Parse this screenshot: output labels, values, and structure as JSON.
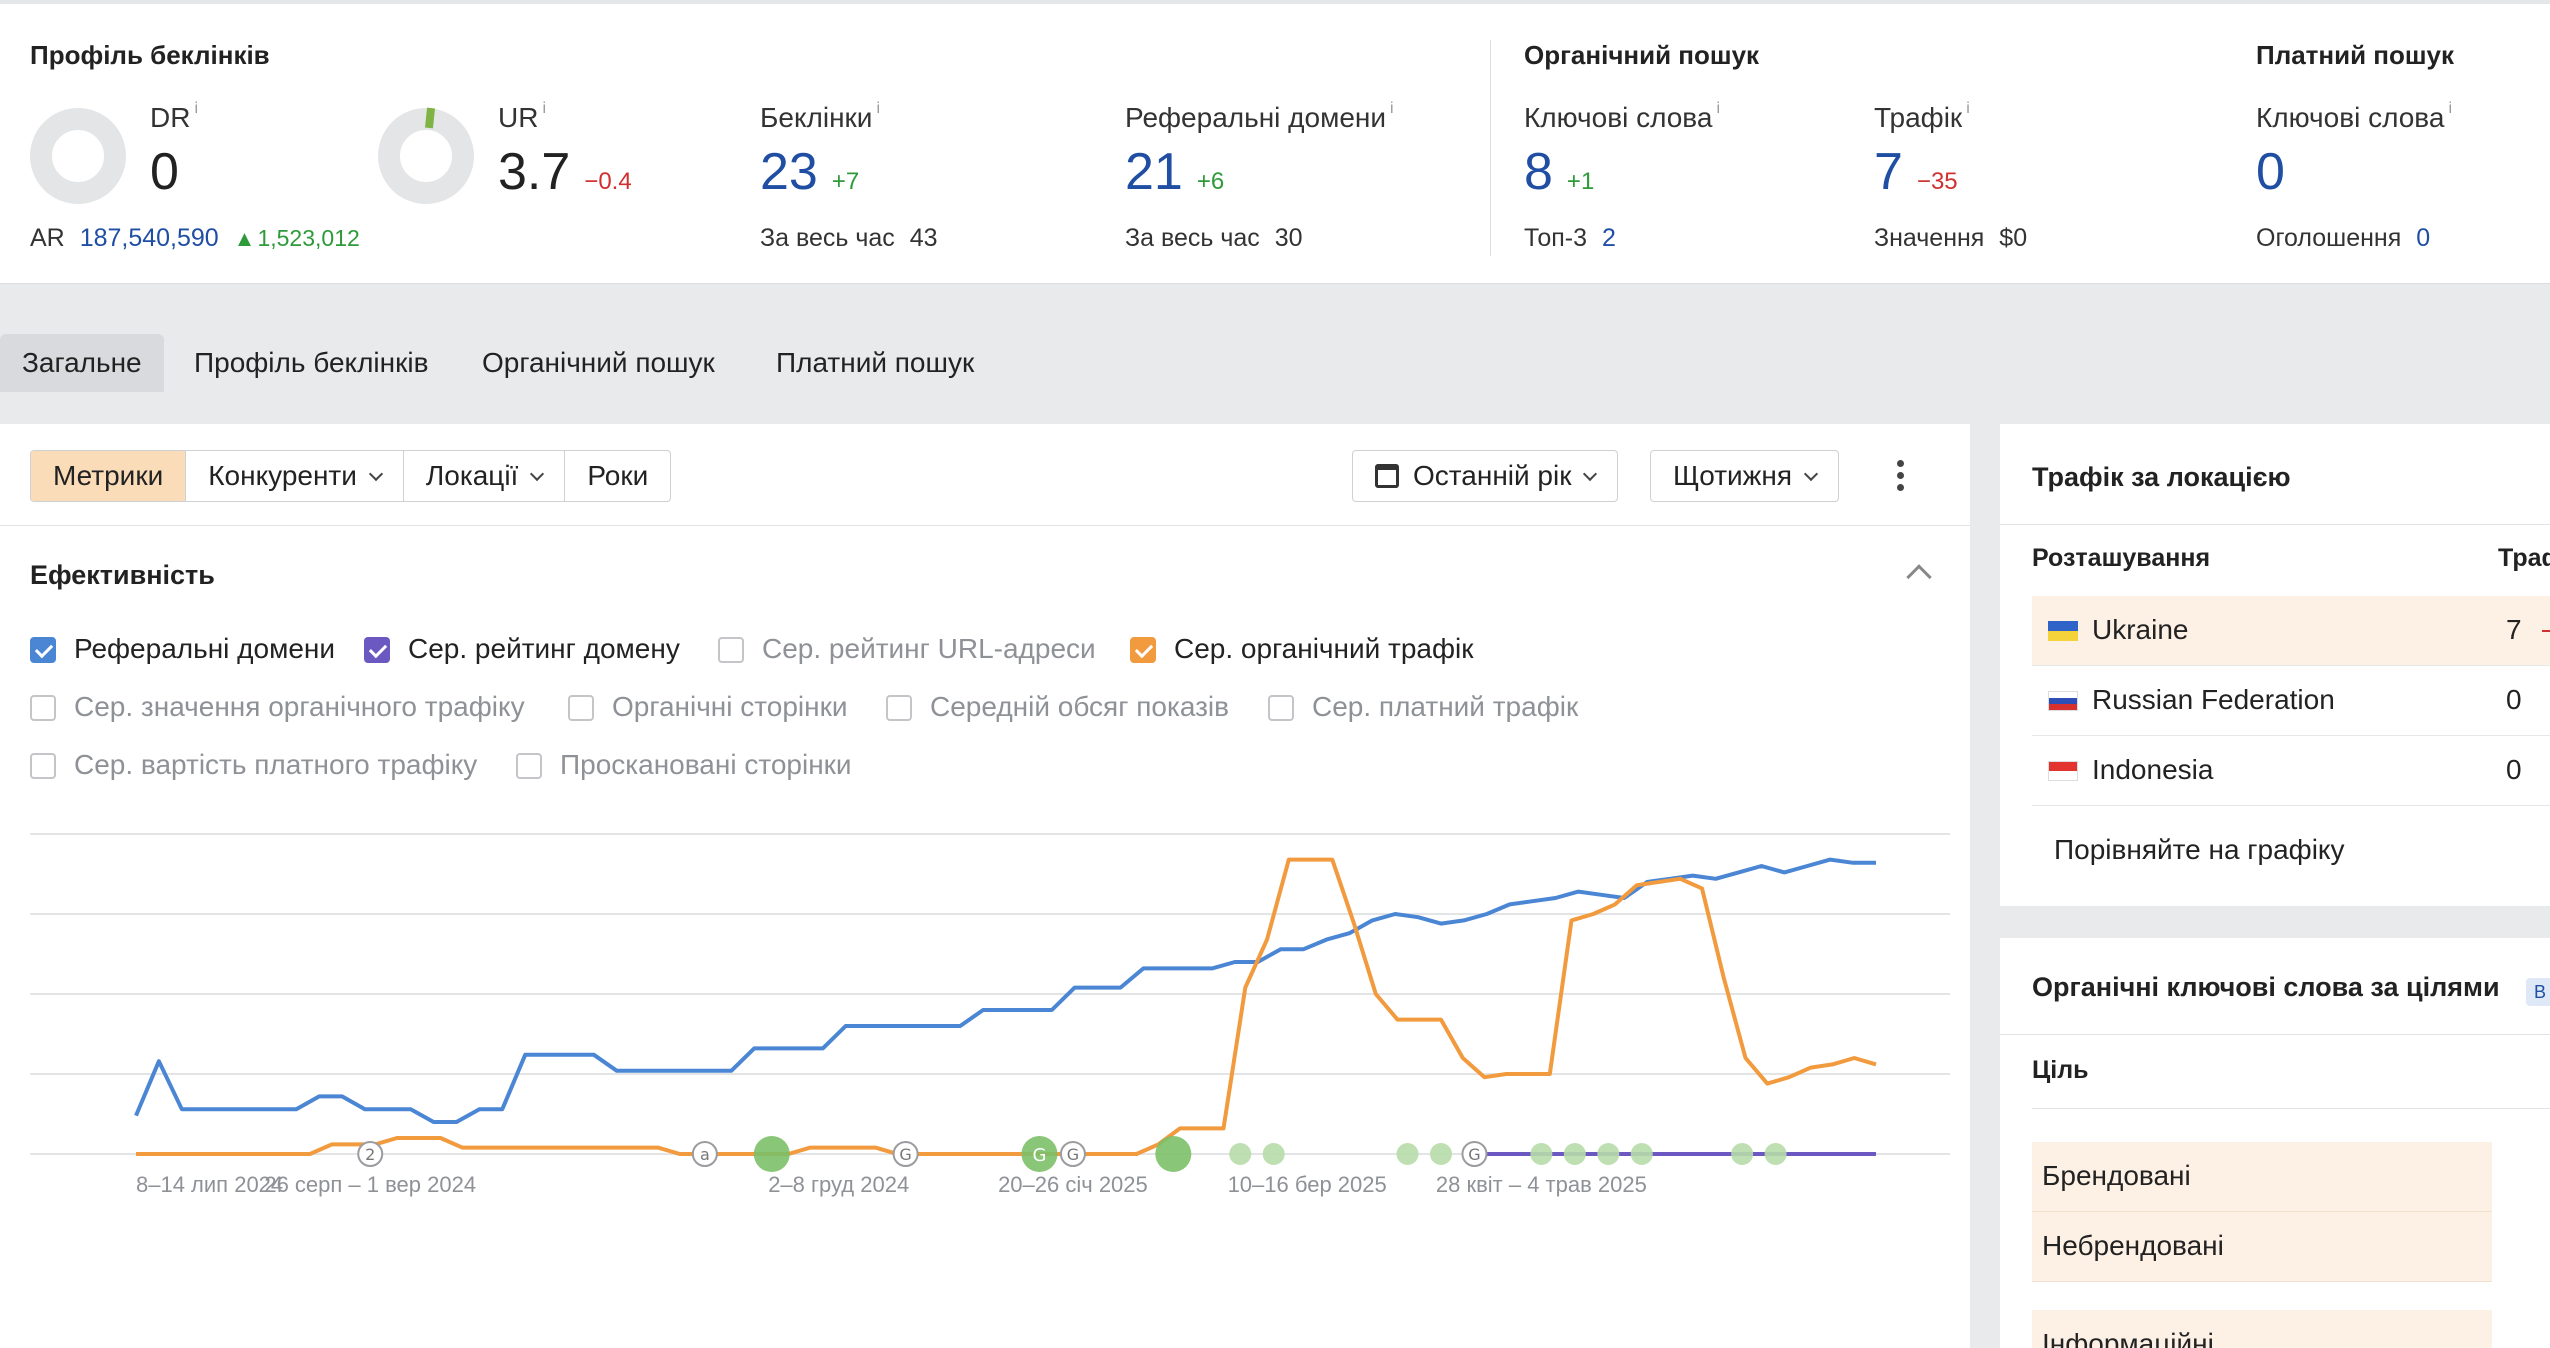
{
  "backlinks_profile": {
    "title": "Профіль беклінків",
    "dr": {
      "label": "DR",
      "value": "0"
    },
    "ar": {
      "label": "AR",
      "value": "187,540,590",
      "delta": "1,523,012"
    },
    "ur": {
      "label": "UR",
      "value": "3.7",
      "delta": "−0.4",
      "fill_percent": 3.7
    },
    "backlinks": {
      "label": "Беклінки",
      "value": "23",
      "delta": "+7",
      "sub_label": "За весь час",
      "sub_value": "43"
    },
    "ref_domains": {
      "label": "Реферальні домени",
      "value": "21",
      "delta": "+6",
      "sub_label": "За весь час",
      "sub_value": "30"
    }
  },
  "organic_search": {
    "title": "Органічний пошук",
    "keywords": {
      "label": "Ключові слова",
      "value": "8",
      "delta": "+1",
      "sub_label": "Топ-3",
      "sub_value": "2"
    },
    "traffic": {
      "label": "Трафік",
      "value": "7",
      "delta": "−35",
      "sub_label": "Значення",
      "sub_value": "$0"
    }
  },
  "paid_search": {
    "title": "Платний пошук",
    "keywords": {
      "label": "Ключові слова",
      "value": "0",
      "sub_label": "Оголошення",
      "sub_value": "0"
    }
  },
  "info_mark": "i",
  "nav_tabs": [
    "Загальне",
    "Профіль беклінків",
    "Органічний пошук",
    "Платний пошук"
  ],
  "toolbar": {
    "segments": [
      "Метрики",
      "Конкуренти",
      "Локації",
      "Роки"
    ],
    "period": "Останній рік",
    "interval": "Щотижня"
  },
  "performance": {
    "title": "Ефективність",
    "checkboxes": [
      {
        "label": "Реферальні домени",
        "checked": true,
        "color": "#4a86d4"
      },
      {
        "label": "Сер. рейтинг домену",
        "checked": true,
        "color": "#6b58c0"
      },
      {
        "label": "Сер. рейтинг URL-адреси",
        "checked": false
      },
      {
        "label": "Сер. органічний трафік",
        "checked": true,
        "color": "#f19a3e"
      },
      {
        "label": "Сер. значення органічного трафіку",
        "checked": false
      },
      {
        "label": "Органічні сторінки",
        "checked": false
      },
      {
        "label": "Середній обсяг показів",
        "checked": false
      },
      {
        "label": "Сер. платний трафік",
        "checked": false
      },
      {
        "label": "Сер. вартість платного трафіку",
        "checked": false
      },
      {
        "label": "Проскановані сторінки",
        "checked": false
      }
    ]
  },
  "chart_data": {
    "type": "line",
    "x_tick_labels": [
      "8–14 лип 2024",
      "26 серп – 1 вер 2024",
      "2–8 груд 2024",
      "20–26 січ 2025",
      "10–16 бер 2025",
      "28 квіт – 4 трав 2025"
    ],
    "x_tick_weeks": [
      0,
      7,
      21,
      28,
      35,
      42
    ],
    "week_count": 52,
    "ylim": [
      0,
      100
    ],
    "grid": true,
    "series": [
      {
        "name": "Реферальні домени",
        "color": "#4a86d4",
        "values": [
          12,
          29,
          14,
          14,
          14,
          14,
          14,
          14,
          18,
          18,
          14,
          14,
          14,
          10,
          10,
          14,
          14,
          31,
          31,
          31,
          31,
          26,
          26,
          26,
          26,
          26,
          26,
          33,
          33,
          33,
          33,
          40,
          40,
          40,
          40,
          40,
          40,
          45,
          45,
          45,
          45,
          52,
          52,
          52,
          58,
          58,
          58,
          58,
          60,
          60,
          64,
          64,
          67,
          69,
          73,
          75,
          74,
          72,
          73,
          75,
          78,
          79,
          80,
          82,
          81,
          80,
          85,
          86,
          87,
          86,
          88,
          90,
          88,
          90,
          92,
          91,
          91
        ]
      },
      {
        "name": "Сер. органічний трафік",
        "color": "#f19a3e",
        "values": [
          0,
          0,
          0,
          0,
          0,
          0,
          0,
          0,
          0,
          3,
          3,
          3,
          5,
          5,
          5,
          2,
          2,
          2,
          2,
          2,
          2,
          2,
          2,
          2,
          2,
          0,
          0,
          0,
          0,
          0,
          0,
          2,
          2,
          2,
          2,
          0,
          0,
          0,
          0,
          0,
          0,
          0,
          0,
          0,
          0,
          0,
          0,
          3,
          8,
          8,
          8,
          52,
          67,
          92,
          92,
          92,
          72,
          50,
          42,
          42,
          42,
          30,
          24,
          25,
          25,
          25,
          73,
          75,
          78,
          84,
          85,
          86,
          83,
          55,
          30,
          22,
          24,
          27,
          28,
          30,
          28
        ]
      },
      {
        "name": "Сер. рейтинг домену",
        "color": "#6b58c0",
        "values": []
      }
    ],
    "events": [
      {
        "week": 7,
        "kind": "marker",
        "label": "2"
      },
      {
        "week": 17,
        "kind": "marker",
        "label": "a"
      },
      {
        "week": 19,
        "kind": "dot",
        "size": "large"
      },
      {
        "week": 23,
        "kind": "marker",
        "label": "G"
      },
      {
        "week": 27,
        "kind": "dot",
        "size": "large",
        "label": "G"
      },
      {
        "week": 28,
        "kind": "marker",
        "label": "G"
      },
      {
        "week": 31,
        "kind": "dot",
        "size": "large"
      },
      {
        "week": 33,
        "kind": "dot"
      },
      {
        "week": 34,
        "kind": "dot"
      },
      {
        "week": 38,
        "kind": "dot"
      },
      {
        "week": 39,
        "kind": "dot"
      },
      {
        "week": 40,
        "kind": "marker",
        "label": "G"
      },
      {
        "week": 42,
        "kind": "dot"
      },
      {
        "week": 43,
        "kind": "dot"
      },
      {
        "week": 44,
        "kind": "dot"
      },
      {
        "week": 45,
        "kind": "dot"
      },
      {
        "week": 48,
        "kind": "dot"
      },
      {
        "week": 49,
        "kind": "dot"
      }
    ]
  },
  "traffic_by_location": {
    "title": "Трафік за локацією",
    "col_location": "Розташування",
    "col_traffic": "Трафік",
    "rows": [
      {
        "name": "Ukraine",
        "value": "7"
      },
      {
        "name": "Russian Federation",
        "value": "0"
      },
      {
        "name": "Indonesia",
        "value": "0"
      }
    ],
    "compare_link": "Порівняйте на графіку"
  },
  "organic_keywords_by_intent": {
    "title": "Органічні ключові слова за цілями",
    "badge": "B",
    "col_intent": "Ціль",
    "rows": [
      "Брендовані",
      "Небрендовані",
      "Інформаційні"
    ]
  }
}
